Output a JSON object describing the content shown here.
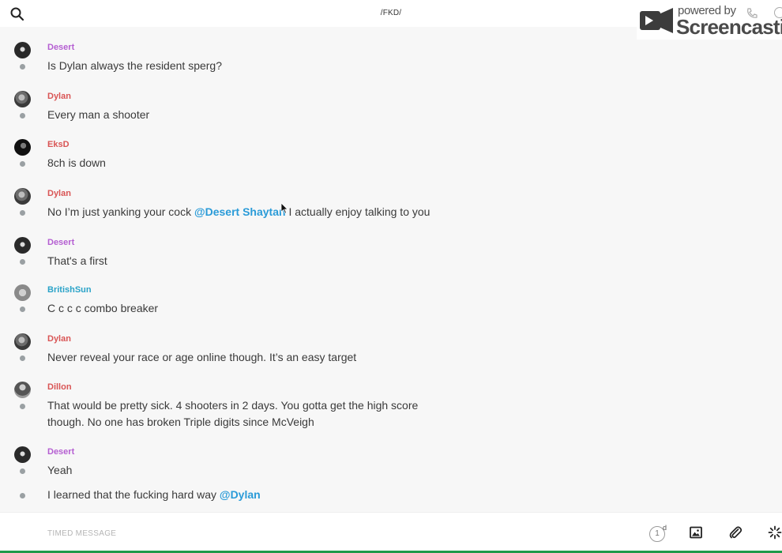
{
  "header": {
    "channel": "/FKD/",
    "search_icon": "search-icon"
  },
  "watermark": {
    "powered": "powered by",
    "brand": "Screencastify"
  },
  "messages": [
    {
      "author": "Desert",
      "color": "#b55fd2",
      "text": "Is Dylan always the resident sperg?"
    },
    {
      "author": "Dylan",
      "color": "#d95555",
      "text": "Every man a shooter"
    },
    {
      "author": "EksD",
      "color": "#d95555",
      "text": "8ch is down"
    },
    {
      "author": "Dylan",
      "color": "#d95555",
      "text_before": "No I’m just yanking your cock ",
      "mention": "@Desert Shaytan",
      "text_after": " I actually enjoy talking to you"
    },
    {
      "author": "Desert",
      "color": "#b55fd2",
      "text": "That's a first"
    },
    {
      "author": "BritishSun",
      "color": "#2aa3c8",
      "text": "C c c c combo breaker"
    },
    {
      "author": "Dylan",
      "color": "#d95555",
      "text": "Never reveal your race or age online though. It’s an easy target"
    },
    {
      "author": "Dillon",
      "color": "#d95555",
      "text_line1": "That would be pretty sick. 4 shooters in 2 days. You gotta get the high score",
      "text_line2": "though. No one has broken Triple digits since McVeigh"
    },
    {
      "author": "Desert",
      "color": "#b55fd2",
      "text": "Yeah"
    },
    {
      "text_before": "I learned that the fucking hard way ",
      "mention": "@Dylan"
    }
  ],
  "composer": {
    "placeholder": "TIMED MESSAGE",
    "timer_value": "1",
    "timer_unit": "d"
  },
  "colors": {
    "mention": "#2a9bd8",
    "accent_bar": "#1f9a4a"
  }
}
